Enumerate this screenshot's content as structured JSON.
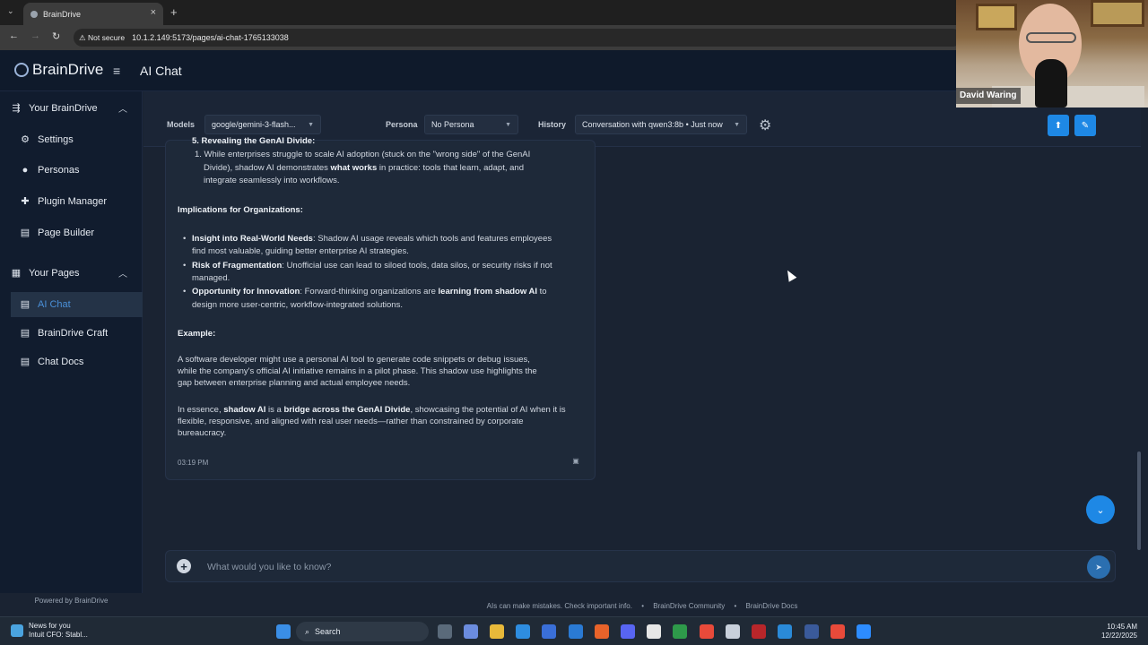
{
  "browser": {
    "tab_title": "BrainDrive",
    "security": "Not secure",
    "url": "10.1.2.149:5173/pages/ai-chat-1765133038"
  },
  "app": {
    "logo_text": "BrainDrive",
    "page_title": "AI Chat",
    "accent_color": "#1e88e5"
  },
  "sidebar": {
    "section_your_braindrive": "Your BrainDrive",
    "items": [
      {
        "label": "Settings",
        "icon": "gear-icon"
      },
      {
        "label": "Personas",
        "icon": "person-icon"
      },
      {
        "label": "Plugin Manager",
        "icon": "puzzle-icon"
      },
      {
        "label": "Page Builder",
        "icon": "document-icon"
      }
    ],
    "section_your_pages": "Your Pages",
    "pages": [
      {
        "label": "AI Chat",
        "icon": "document-icon",
        "active": true
      },
      {
        "label": "BrainDrive Craft",
        "icon": "document-icon"
      },
      {
        "label": "Chat Docs",
        "icon": "document-icon"
      }
    ],
    "powered_by": "Powered by BrainDrive"
  },
  "toolbar": {
    "models_label": "Models",
    "models_value": "google/gemini-3-flash...",
    "persona_label": "Persona",
    "persona_value": "No Persona",
    "history_label": "History",
    "history_value": "Conversation with qwen3:8b • Just now"
  },
  "message": {
    "heading5": "5. Revealing the GenAI Divide:",
    "sub1_l1": "1. While enterprises struggle to scale AI adoption (stuck on the \"wrong side\" of the GenAI",
    "sub1_l2": "Divide), shadow AI demonstrates",
    "sub1_l2_bold": "what works",
    "sub1_l2_end": "in practice: tools that learn, adapt, and",
    "sub1_l3": "integrate seamlessly into workflows.",
    "implications_heading": "Implications for Organizations:",
    "b1_bold": "Insight into Real-World Needs",
    "b1_l1": ": Shadow AI usage reveals which tools and features employees",
    "b1_l2": "find most valuable, guiding better enterprise AI strategies.",
    "b2_bold": "Risk of Fragmentation",
    "b2_l1": ": Unofficial use can lead to siloed tools, data silos, or security risks if not",
    "b2_l2": "managed.",
    "b3_bold": "Opportunity for Innovation",
    "b3_l1": ": Forward-thinking organizations are",
    "b3_l1_bold": "learning from shadow AI",
    "b3_l1_end": "to",
    "b3_l2": "design more user-centric, workflow-integrated solutions.",
    "example_heading": "Example:",
    "ex_l1": "A software developer might use a personal AI tool to generate code snippets or debug issues,",
    "ex_l2": "while the company's official AI initiative remains in a pilot phase. This shadow use highlights the",
    "ex_l3": "gap between enterprise planning and actual employee needs.",
    "ess_start": "In essence,",
    "ess_bold1": "shadow AI",
    "ess_mid": "is a",
    "ess_bold2": "bridge across the GenAI Divide",
    "ess_l1_end": ", showcasing the potential of AI when it is",
    "ess_l2": "flexible, responsive, and aligned with real user needs—rather than constrained by corporate",
    "ess_l3": "bureaucracy.",
    "timestamp": "03:19 PM"
  },
  "input": {
    "placeholder": "What would you like to know?"
  },
  "footer": {
    "disclaimer": "AIs can make mistakes. Check important info.",
    "community": "BrainDrive Community",
    "docs": "BrainDrive Docs"
  },
  "webcam": {
    "name": "David Waring"
  },
  "taskbar": {
    "news_title": "News for you",
    "news_sub": "Intuit CFO: Stabl...",
    "search_label": "Search",
    "time": "10:45 AM",
    "date": "12/22/2025"
  }
}
